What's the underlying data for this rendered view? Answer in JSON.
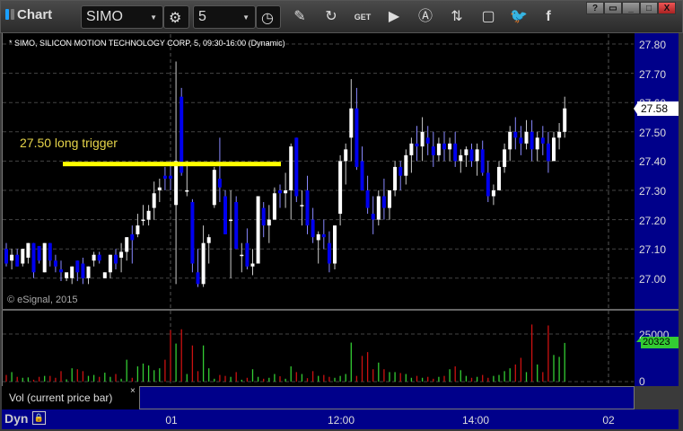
{
  "toolbar": {
    "title": "Chart",
    "symbol": "SIMO",
    "interval": "5",
    "icons": [
      "settings-icon",
      "clock-icon",
      "pencil-icon",
      "refresh-icon",
      "get-icon",
      "play-icon",
      "alert-icon",
      "link-icon",
      "comment-icon",
      "twitter-icon",
      "facebook-icon"
    ],
    "window_buttons": [
      "?",
      "▭",
      "_",
      "□",
      "X"
    ]
  },
  "chart_title": "* SIMO, SILICON MOTION TECHNOLOGY CORP, 5, 09:30-16:00 (Dynamic)",
  "copyright": "© eSignal, 2015",
  "annotation": "27.50 long trigger",
  "price_axis": {
    "ticks": [
      "27.80",
      "27.70",
      "27.60",
      "27.50",
      "27.40",
      "27.30",
      "27.20",
      "27.10",
      "27.00"
    ],
    "current": "27.58"
  },
  "volume_axis": {
    "ticks": [
      "25000",
      "0"
    ],
    "current": "20323"
  },
  "volume_label": "Vol (current price bar)",
  "volume_close": "×",
  "time_axis": [
    "01",
    "12:00",
    "14:00",
    "02"
  ],
  "status": "Dyn",
  "colors": {
    "up": "#ffffff",
    "down": "#0000ee",
    "vol_up": "#33cc33",
    "vol_down": "#cc1111",
    "trigger": "#ffff00"
  },
  "chart_data": {
    "type": "candlestick",
    "ylim": [
      26.93,
      27.83
    ],
    "trigger_level": 27.39,
    "bars": [
      [
        27.1,
        27.12,
        27.04,
        27.05,
        3500
      ],
      [
        27.06,
        27.1,
        27.03,
        27.08,
        5000
      ],
      [
        27.08,
        27.1,
        27.04,
        27.04,
        2500
      ],
      [
        27.05,
        27.1,
        27.04,
        27.1,
        2000
      ],
      [
        27.07,
        27.12,
        27.05,
        27.12,
        2200
      ],
      [
        27.12,
        27.12,
        27.0,
        27.02,
        1000
      ],
      [
        27.11,
        27.11,
        27.05,
        27.06,
        2500
      ],
      [
        27.02,
        27.12,
        27.02,
        27.12,
        3000
      ],
      [
        27.12,
        27.12,
        27.04,
        27.06,
        3000
      ],
      [
        27.06,
        27.08,
        27.02,
        27.04,
        2000
      ],
      [
        27.03,
        27.06,
        26.99,
        27.02,
        5500
      ],
      [
        27.0,
        27.0,
        26.99,
        27.02,
        1200
      ],
      [
        27.0,
        27.04,
        26.98,
        27.04,
        7000
      ],
      [
        27.06,
        27.06,
        26.99,
        27.02,
        6500
      ],
      [
        27.05,
        27.07,
        26.98,
        27.0,
        5500
      ],
      [
        27.0,
        27.04,
        26.98,
        27.04,
        3000
      ],
      [
        27.06,
        27.09,
        27.04,
        27.08,
        3500
      ],
      [
        27.08,
        27.09,
        27.05,
        27.06,
        2500
      ],
      [
        27.0,
        27.02,
        27.0,
        27.02,
        4700
      ],
      [
        27.02,
        27.08,
        27.0,
        27.08,
        2500
      ],
      [
        27.08,
        27.1,
        27.03,
        27.05,
        4000
      ],
      [
        27.07,
        27.12,
        27.02,
        27.09,
        1500
      ],
      [
        27.09,
        27.14,
        27.06,
        27.14,
        11500
      ],
      [
        27.15,
        27.18,
        27.05,
        27.13,
        2000
      ],
      [
        27.15,
        27.22,
        27.14,
        27.18,
        8000
      ],
      [
        27.2,
        27.25,
        27.18,
        27.2,
        9500
      ],
      [
        27.2,
        27.25,
        27.18,
        27.23,
        8500
      ],
      [
        27.24,
        27.33,
        27.2,
        27.29,
        6000
      ],
      [
        27.3,
        27.34,
        27.26,
        27.31,
        7000
      ],
      [
        27.35,
        27.38,
        27.3,
        27.34,
        11500
      ],
      [
        27.35,
        27.4,
        27.3,
        27.34,
        27000
      ],
      [
        27.25,
        27.74,
        26.98,
        27.4,
        20000
      ],
      [
        27.62,
        27.65,
        27.35,
        27.36,
        27500
      ],
      [
        27.3,
        27.4,
        27.28,
        27.3,
        4000
      ],
      [
        27.26,
        27.27,
        27.02,
        27.05,
        19000
      ],
      [
        27.02,
        27.1,
        26.97,
        26.98,
        5500
      ],
      [
        26.98,
        27.18,
        26.97,
        27.12,
        19000
      ],
      [
        27.12,
        27.15,
        27.05,
        27.14,
        7000
      ],
      [
        27.25,
        27.38,
        27.24,
        27.37,
        1500
      ],
      [
        27.34,
        27.48,
        27.26,
        27.31,
        3500
      ],
      [
        27.28,
        27.3,
        27.15,
        27.15,
        3000
      ],
      [
        27.2,
        27.3,
        27.0,
        27.2,
        2500
      ],
      [
        27.26,
        27.28,
        27.1,
        27.1,
        5000
      ],
      [
        27.08,
        27.12,
        27.02,
        27.08,
        1000
      ],
      [
        27.12,
        27.17,
        27.03,
        27.04,
        2000
      ],
      [
        27.04,
        27.1,
        27.01,
        27.05,
        6500
      ],
      [
        27.05,
        27.28,
        27.05,
        27.28,
        2500
      ],
      [
        27.24,
        27.26,
        27.14,
        27.18,
        1500
      ],
      [
        27.18,
        27.25,
        27.12,
        27.2,
        2000
      ],
      [
        27.2,
        27.31,
        27.2,
        27.29,
        4000
      ],
      [
        27.3,
        27.32,
        27.24,
        27.29,
        2800
      ],
      [
        27.29,
        27.36,
        27.24,
        27.3,
        1500
      ],
      [
        27.3,
        27.46,
        27.2,
        27.45,
        8000
      ],
      [
        27.48,
        27.48,
        27.26,
        27.28,
        5000
      ],
      [
        27.25,
        27.3,
        27.18,
        27.25,
        4000
      ],
      [
        27.3,
        27.35,
        27.15,
        27.18,
        1800
      ],
      [
        27.2,
        27.24,
        27.12,
        27.14,
        5500
      ],
      [
        27.13,
        27.16,
        27.05,
        27.15,
        3000
      ],
      [
        27.15,
        27.2,
        27.1,
        27.14,
        3500
      ],
      [
        27.12,
        27.16,
        27.02,
        27.05,
        2500
      ],
      [
        27.05,
        27.18,
        27.03,
        27.18,
        2000
      ],
      [
        27.22,
        27.42,
        27.18,
        27.4,
        3000
      ],
      [
        27.4,
        27.46,
        27.32,
        27.44,
        4000
      ],
      [
        27.48,
        27.68,
        27.4,
        27.58,
        20500
      ],
      [
        27.58,
        27.65,
        27.37,
        27.38,
        3000
      ],
      [
        27.4,
        27.45,
        27.3,
        27.3,
        13500
      ],
      [
        27.3,
        27.35,
        27.22,
        27.24,
        15500
      ],
      [
        27.22,
        27.28,
        27.15,
        27.2,
        6500
      ],
      [
        27.2,
        27.3,
        27.18,
        27.28,
        10000
      ],
      [
        27.28,
        27.34,
        27.2,
        27.24,
        6500
      ],
      [
        27.24,
        27.3,
        27.2,
        27.3,
        5000
      ],
      [
        27.3,
        27.4,
        27.28,
        27.38,
        5000
      ],
      [
        27.38,
        27.4,
        27.3,
        27.35,
        4500
      ],
      [
        27.35,
        27.44,
        27.32,
        27.42,
        4000
      ],
      [
        27.42,
        27.48,
        27.36,
        27.46,
        2000
      ],
      [
        27.46,
        27.52,
        27.4,
        27.45,
        3000
      ],
      [
        27.45,
        27.55,
        27.4,
        27.5,
        2000
      ],
      [
        27.48,
        27.52,
        27.42,
        27.46,
        2500
      ],
      [
        27.45,
        27.5,
        27.38,
        27.42,
        1500
      ],
      [
        27.42,
        27.48,
        27.4,
        27.46,
        2500
      ],
      [
        27.46,
        27.5,
        27.4,
        27.44,
        3000
      ],
      [
        27.44,
        27.48,
        27.4,
        27.46,
        6500
      ],
      [
        27.46,
        27.5,
        27.38,
        27.4,
        8000
      ],
      [
        27.4,
        27.44,
        27.36,
        27.42,
        6000
      ],
      [
        27.42,
        27.45,
        27.38,
        27.44,
        3000
      ],
      [
        27.44,
        27.46,
        27.38,
        27.4,
        2000
      ],
      [
        27.4,
        27.46,
        27.35,
        27.44,
        2500
      ],
      [
        27.44,
        27.47,
        27.35,
        27.36,
        3500
      ],
      [
        27.36,
        27.4,
        27.26,
        27.28,
        2000
      ],
      [
        27.28,
        27.32,
        27.25,
        27.3,
        3000
      ],
      [
        27.3,
        27.4,
        27.3,
        27.38,
        3500
      ],
      [
        27.38,
        27.46,
        27.36,
        27.44,
        5500
      ],
      [
        27.44,
        27.52,
        27.4,
        27.5,
        7000
      ],
      [
        27.5,
        27.55,
        27.44,
        27.48,
        9000
      ],
      [
        27.48,
        27.52,
        27.42,
        27.46,
        12500
      ],
      [
        27.46,
        27.54,
        27.44,
        27.5,
        5000
      ],
      [
        27.5,
        27.54,
        27.4,
        27.44,
        30000
      ],
      [
        27.44,
        27.5,
        27.4,
        27.48,
        9000
      ],
      [
        27.48,
        27.52,
        27.42,
        27.46,
        5000
      ],
      [
        27.46,
        27.5,
        27.36,
        27.4,
        29500
      ],
      [
        27.4,
        27.5,
        27.4,
        27.48,
        14000
      ],
      [
        27.48,
        27.53,
        27.44,
        27.5,
        13000
      ],
      [
        27.5,
        27.62,
        27.48,
        27.58,
        20323
      ]
    ]
  }
}
